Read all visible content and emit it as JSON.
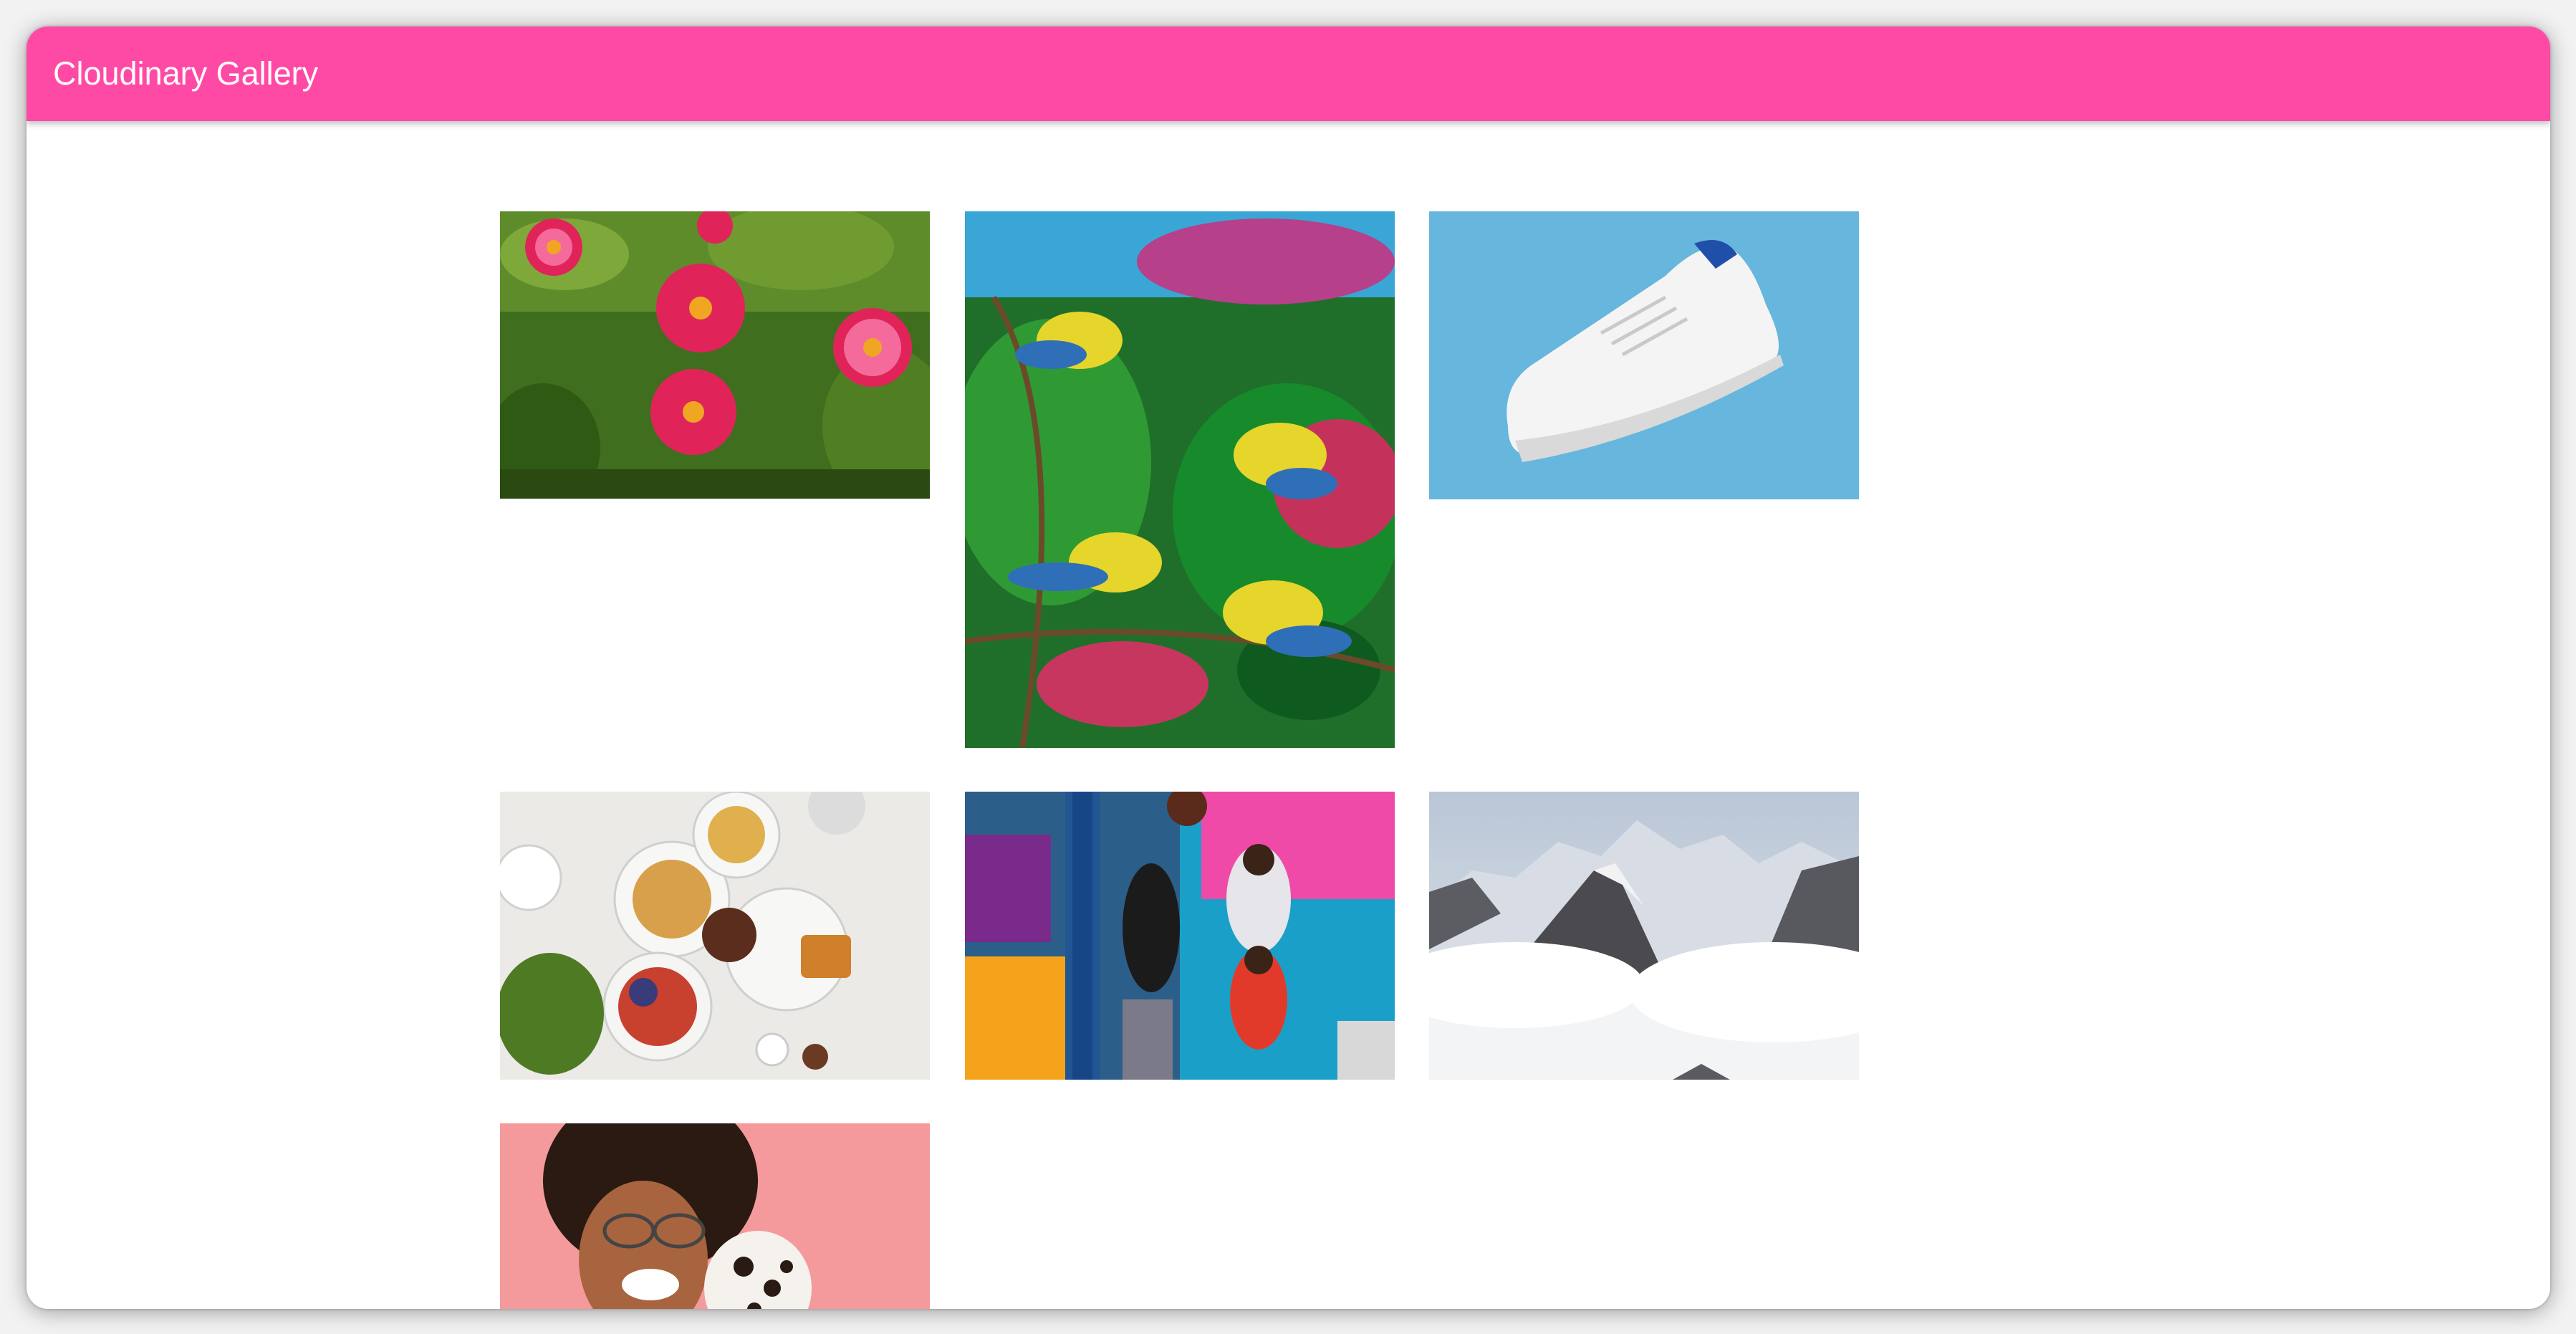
{
  "app": {
    "title": "Cloudinary Gallery",
    "accent_color": "#ff4aa5"
  },
  "gallery": {
    "images": [
      {
        "subject": "pink dahlia flowers"
      },
      {
        "subject": "yellow and blue birds on flowering branch"
      },
      {
        "subject": "white sneaker on blue background"
      },
      {
        "subject": "breakfast table top view"
      },
      {
        "subject": "basketball players against colorful wall"
      },
      {
        "subject": "snowy mountain peaks above clouds"
      },
      {
        "subject": "smiling woman with curly hair and dalmatian"
      }
    ]
  }
}
